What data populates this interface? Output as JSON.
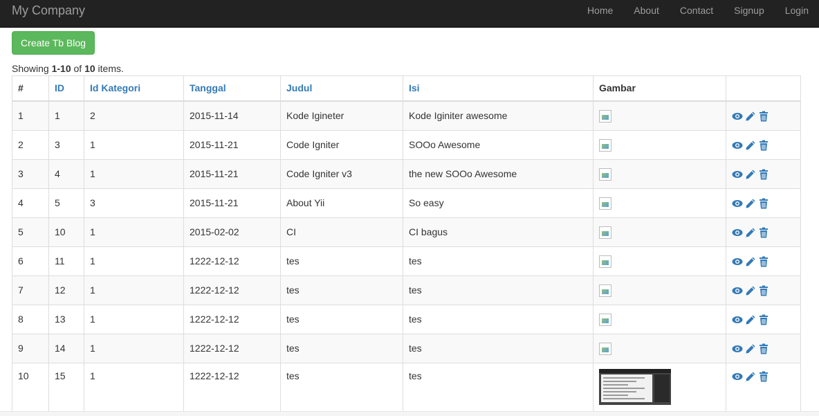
{
  "navbar": {
    "brand": "My Company",
    "items": [
      "Home",
      "About",
      "Contact",
      "Signup",
      "Login"
    ]
  },
  "toolbar": {
    "create_label": "Create Tb Blog"
  },
  "summary": {
    "prefix": "Showing ",
    "range": "1-10",
    "of": " of ",
    "total": "10",
    "suffix": " items."
  },
  "table": {
    "headers": [
      "#",
      "ID",
      "Id Kategori",
      "Tanggal",
      "Judul",
      "Isi",
      "Gambar",
      ""
    ],
    "rows": [
      [
        "1",
        "1",
        "2",
        "2015-11-14",
        "Kode Igineter",
        "Kode Iginiter awesome"
      ],
      [
        "2",
        "3",
        "1",
        "2015-11-21",
        "Code Igniter",
        "SOOo Awesome"
      ],
      [
        "3",
        "4",
        "1",
        "2015-11-21",
        "Code Igniter v3",
        "the new SOOo Awesome"
      ],
      [
        "4",
        "5",
        "3",
        "2015-11-21",
        "About Yii",
        "So easy"
      ],
      [
        "5",
        "10",
        "1",
        "2015-02-02",
        "CI",
        "CI bagus"
      ],
      [
        "6",
        "11",
        "1",
        "1222-12-12",
        "tes",
        "tes"
      ],
      [
        "7",
        "12",
        "1",
        "1222-12-12",
        "tes",
        "tes"
      ],
      [
        "8",
        "13",
        "1",
        "1222-12-12",
        "tes",
        "tes"
      ],
      [
        "9",
        "14",
        "1",
        "1222-12-12",
        "tes",
        "tes"
      ],
      [
        "10",
        "15",
        "1",
        "1222-12-12",
        "tes",
        "tes"
      ]
    ],
    "image_types": [
      "broken-image-icon",
      "broken-image-icon",
      "broken-image-icon",
      "broken-image-icon",
      "broken-image-icon",
      "broken-image-icon",
      "broken-image-icon",
      "broken-image-icon",
      "broken-image-icon",
      "screenshot-thumbnail"
    ],
    "action_icons": [
      "eye-icon",
      "pencil-icon",
      "trash-icon"
    ]
  },
  "colors": {
    "navbar_bg": "#222222",
    "nav_text": "#9d9d9d",
    "success": "#5cb85c",
    "link": "#337ab7"
  }
}
